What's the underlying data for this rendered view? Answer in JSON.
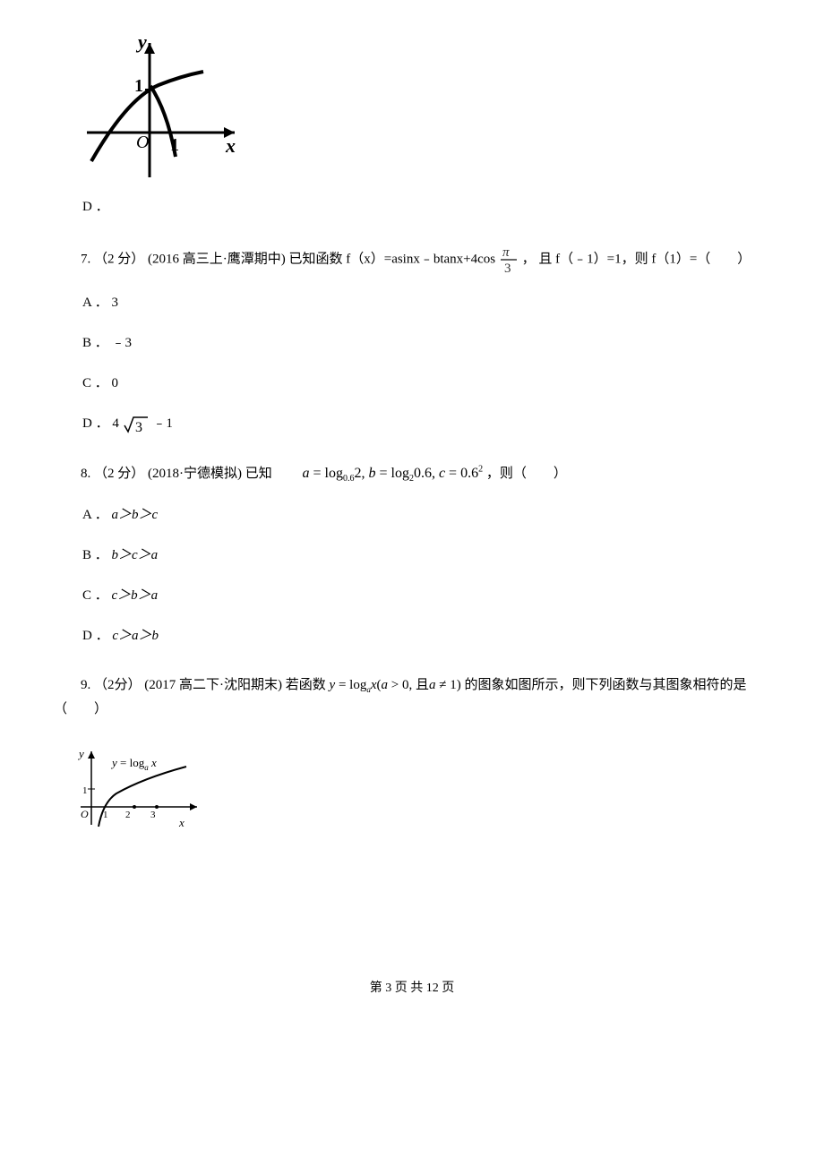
{
  "q6": {
    "optD_label": "D ．"
  },
  "q7": {
    "prefix": "7.  （2 分） (2016 高三上·鹰潭期中) 已知函数 f（x）=asinx﹣btanx+4cos",
    "suffix": "， 且 f（﹣1）=1，则 f（1）=（　　）",
    "optA": "A ． 3",
    "optB": "B ． ﹣3",
    "optC": "C ． 0",
    "optD_pre": "D ． 4",
    "optD_post": " ﹣1"
  },
  "q8": {
    "prefix": "8.  （2 分） (2018·宁德模拟) 已知 ",
    "suffix": " ，则（　　）",
    "optA": "A ． ",
    "optA_f": "a＞b＞c",
    "optB": "B ． ",
    "optB_f": "b＞c＞a",
    "optC": "C ． ",
    "optC_f": "c＞b＞a",
    "optD": "D ． ",
    "optD_f": "c＞a＞b"
  },
  "q9": {
    "prefix": "9.  （2分） (2017 高二下·沈阳期末) 若函数 ",
    "suffix": " 的图象如图所示，则下列函数与其图象相符的是（　　）"
  },
  "footer": "第 3 页 共 12 页"
}
